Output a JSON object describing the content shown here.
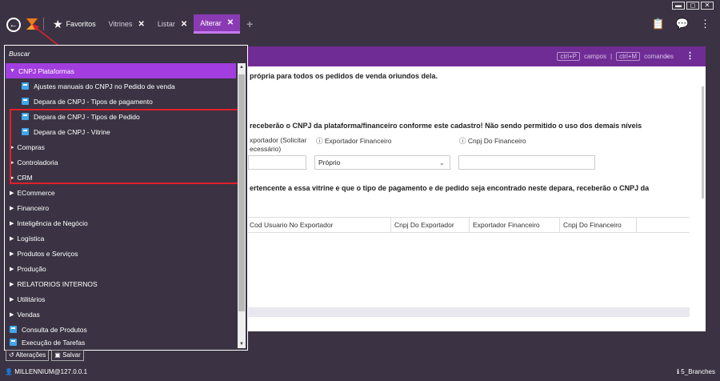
{
  "window": {
    "controls": [
      "▬",
      "◻",
      "✕"
    ]
  },
  "tabs": [
    {
      "label": "Favoritos",
      "icon": "star-icon"
    },
    {
      "label": "Vitrines",
      "close": "✕"
    },
    {
      "label": "Listar",
      "close": "✕"
    },
    {
      "label": "Alterar",
      "close": "✕",
      "active": true
    }
  ],
  "tab_add": "+",
  "header": {
    "kbd1": "ctrl+P",
    "label1": "campos",
    "divider": "|",
    "kbd2": "ctrl+M",
    "label2": "comandos"
  },
  "content": {
    "line1": "própria para todos os pedidos de venda oriundos dela.",
    "line2": "receberão o CNPJ da plataforma/financeiro conforme este cadastro! Não sendo permitido o uso dos demais níveis",
    "label_exportador_a": "xportador (Solicitar",
    "label_exportador_b": "ecessário)",
    "label_exportador_financeiro": "Exportador Financeiro",
    "label_cnpj_financeiro": "Cnpj Do Financeiro",
    "select_value": "Próprio",
    "line3": "ertencente a essa vitrine e que o tipo de pagamento e de pedido seja encontrado neste depara, receberão o CNPJ da",
    "grid_columns": [
      "Cod Usuario No Exportador",
      "Cnpj Do Exportador",
      "Exportador Financeiro",
      "Cnpj Do Financeiro"
    ]
  },
  "menu": {
    "search": "Buscar",
    "open_group": "CNPJ Plataformas",
    "sub_items": [
      "Ajustes manuais do CNPJ no Pedido de venda",
      "Depara de CNPJ - Tipos de pagamento",
      "Depara de CNPJ - Tipos de Pedido",
      "Depara de CNPJ - Vitrine"
    ],
    "groups": [
      "Compras",
      "Controladoria",
      "CRM",
      "ECommerce",
      "Financeiro",
      "Inteligência de Negócio",
      "Logística",
      "Produtos e Serviços",
      "Produção",
      "RELATORIOS INTERNOS",
      "Utilitários",
      "Vendas"
    ],
    "leaves": [
      "Consulta de Produtos",
      "Execução de Tarefas"
    ]
  },
  "footer": {
    "alteracoes": "Alterações",
    "salvar": "Salvar",
    "status_left": "MILLENNIUM@127.0.0.1",
    "status_right": "5_Branches"
  },
  "colors": {
    "accent": "#8a3bb4",
    "menu_open": "#a23de0",
    "header": "#6f2c94",
    "highlight": "#e0202a"
  }
}
